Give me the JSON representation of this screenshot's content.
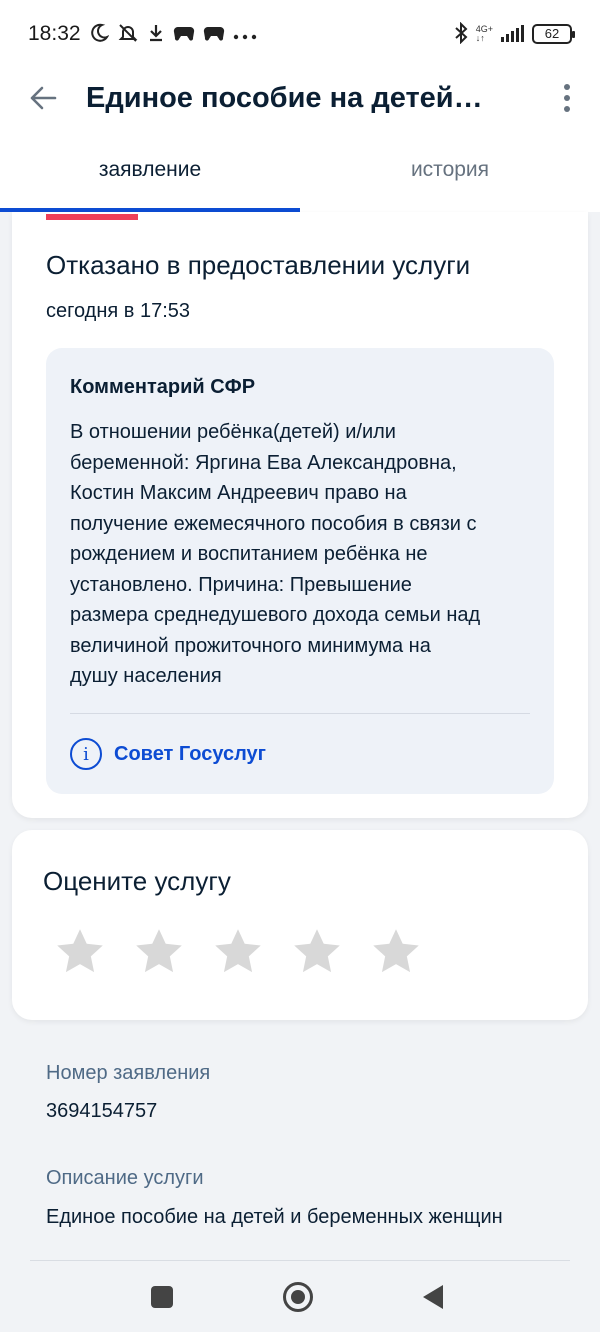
{
  "status_bar": {
    "time": "18:32",
    "network": "4G+",
    "battery": "62",
    "icons": [
      "moon-icon",
      "bell-off-icon",
      "download-icon",
      "gamepad-icon",
      "gamepad-icon",
      "more-dots-icon",
      "bluetooth-icon",
      "signal-icon",
      "battery-icon"
    ]
  },
  "header": {
    "title": "Единое пособие на детей…",
    "back_icon": "arrow-left-icon",
    "menu_icon": "more-vertical-icon"
  },
  "tabs": [
    {
      "label": "заявление",
      "active": true
    },
    {
      "label": "история",
      "active": false
    }
  ],
  "status": {
    "title": "Отказано в предоставлении услуги",
    "time": "сегодня в 17:53",
    "accent_color": "#ee3f58"
  },
  "comment": {
    "title": "Комментарий СФР",
    "lines": [
      "В отношении ребёнка(детей) и/или",
      "беременной: Яргина Ева Александровна,",
      "Костин Максим Андреевич право на",
      "получение ежемесячного пособия в связи с",
      "рождением и воспитанием ребёнка не",
      "установлено. Причина: Превышение",
      "размера среднедушевого дохода семьи над",
      "величиной прожиточного минимума на",
      "душу населения"
    ],
    "advice_label": "Совет Госуслуг",
    "advice_icon": "info-icon"
  },
  "rating": {
    "title": "Оцените услугу",
    "max_stars": 5,
    "selected": 0,
    "star_color": "#d8d8d8"
  },
  "application": {
    "number_label": "Номер заявления",
    "number_value": "3694154757",
    "description_label": "Описание услуги",
    "description_value": "Единое пособие на детей и беременных женщин"
  },
  "colors": {
    "primary": "#0d4cd3",
    "background": "#f1f3f6",
    "text": "#0b1f33",
    "secondary_text": "#66727f"
  }
}
